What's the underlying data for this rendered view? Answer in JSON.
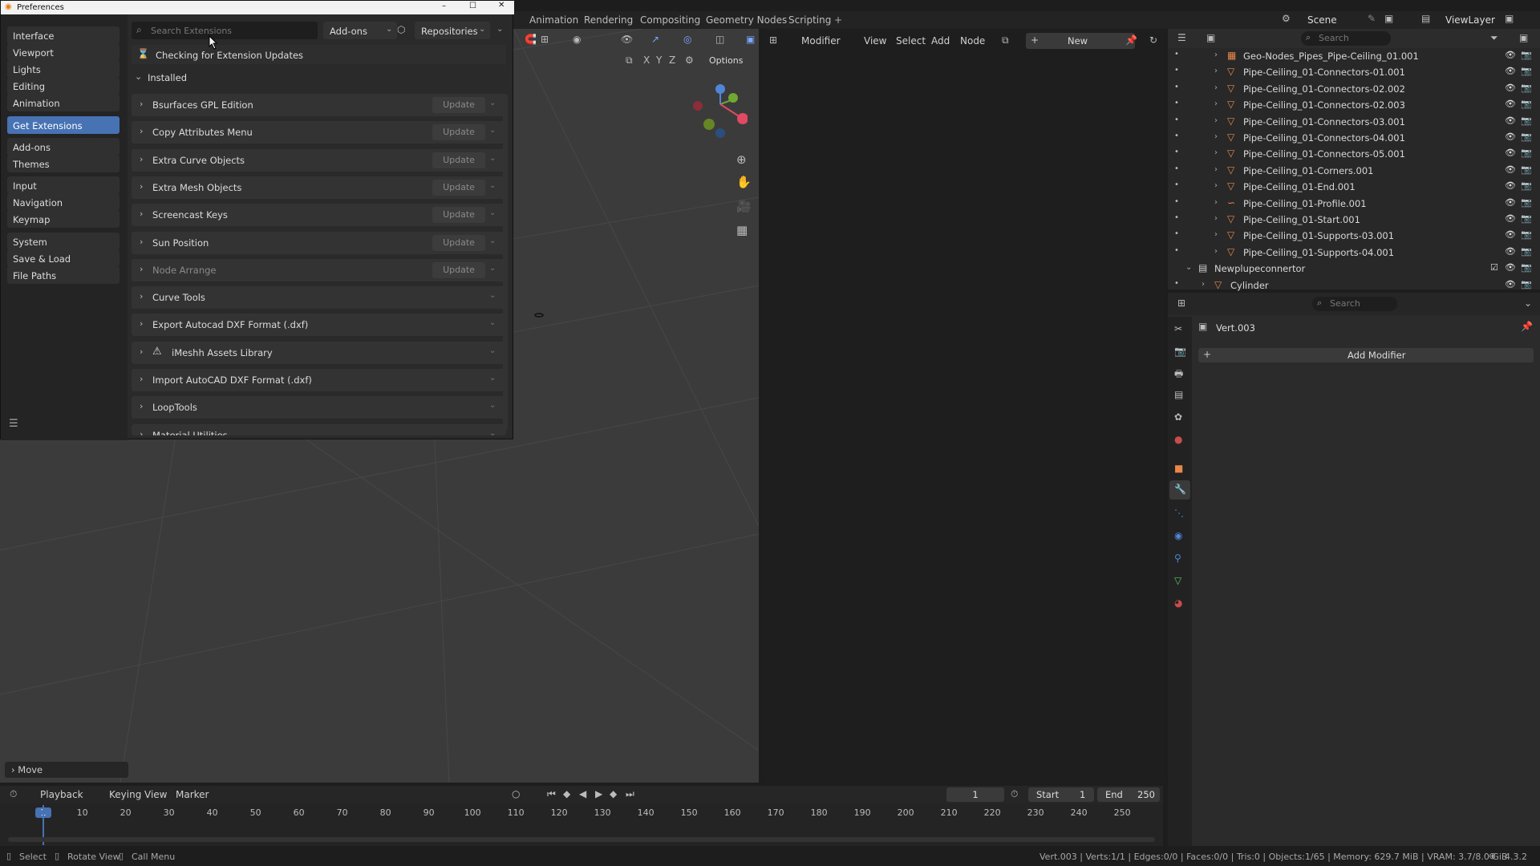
{
  "workspace_tabs": [
    "Animation",
    "Rendering",
    "Compositing",
    "Geometry Nodes",
    "Scripting"
  ],
  "add_workspace": "+",
  "scene": {
    "label": "Scene",
    "view_layer": "ViewLayer"
  },
  "viewport": {
    "axes": [
      "X",
      "Y",
      "Z"
    ],
    "options_label": "Options"
  },
  "node_editor": {
    "editor_type": "Modifier",
    "menu": [
      "View",
      "Select",
      "Add",
      "Node"
    ],
    "new_label": "New"
  },
  "outliner": {
    "search_placeholder": "Search",
    "rows": [
      {
        "name": "Geo-Nodes_Pipes_Pipe-Ceiling_01.001",
        "icon": "geo-nodes-icon"
      },
      {
        "name": "Pipe-Ceiling_01-Connectors-01.001",
        "icon": "mesh-icon"
      },
      {
        "name": "Pipe-Ceiling_01-Connectors-02.002",
        "icon": "mesh-icon"
      },
      {
        "name": "Pipe-Ceiling_01-Connectors-02.003",
        "icon": "mesh-icon"
      },
      {
        "name": "Pipe-Ceiling_01-Connectors-03.001",
        "icon": "mesh-icon"
      },
      {
        "name": "Pipe-Ceiling_01-Connectors-04.001",
        "icon": "mesh-icon"
      },
      {
        "name": "Pipe-Ceiling_01-Connectors-05.001",
        "icon": "mesh-icon"
      },
      {
        "name": "Pipe-Ceiling_01-Corners.001",
        "icon": "mesh-icon"
      },
      {
        "name": "Pipe-Ceiling_01-End.001",
        "icon": "mesh-icon"
      },
      {
        "name": "Pipe-Ceiling_01-Profile.001",
        "icon": "curve-icon"
      },
      {
        "name": "Pipe-Ceiling_01-Start.001",
        "icon": "mesh-icon"
      },
      {
        "name": "Pipe-Ceiling_01-Supports-03.001",
        "icon": "mesh-icon"
      },
      {
        "name": "Pipe-Ceiling_01-Supports-04.001",
        "icon": "mesh-icon"
      },
      {
        "name": "Newplupeconnertor",
        "icon": "collection-icon"
      },
      {
        "name": "Cylinder",
        "icon": "mesh-icon"
      }
    ]
  },
  "properties": {
    "search_placeholder": "Search",
    "object_name": "Vert.003",
    "add_modifier": "Add Modifier"
  },
  "timeline": {
    "menu": [
      "Playback",
      "Keying",
      "View",
      "Marker"
    ],
    "current_frame": "1",
    "start_label": "Start",
    "start": "1",
    "end_label": "End",
    "end": "250",
    "ticks": [
      "1",
      "10",
      "20",
      "30",
      "40",
      "50",
      "60",
      "70",
      "80",
      "90",
      "100",
      "110",
      "120",
      "130",
      "140",
      "150",
      "160",
      "170",
      "180",
      "190",
      "200",
      "210",
      "220",
      "230",
      "240",
      "250"
    ]
  },
  "status_bar": {
    "left": [
      {
        "icon": "mouse-left-icon",
        "label": "Select"
      },
      {
        "icon": "mouse-middle-icon",
        "label": "Rotate View"
      },
      {
        "icon": "mouse-right-icon",
        "label": "Call Menu"
      }
    ],
    "right": "Vert.003 | Verts:1/1 | Edges:0/0 | Faces:0/0 | Tris:0 | Objects:1/65 | Memory: 629.7 MiB | VRAM: 3.7/8.0 GiB",
    "version": "4.3.2"
  },
  "last_operator": "Move",
  "preferences": {
    "title": "Preferences",
    "sidebar": [
      {
        "label": "Interface",
        "group": 1
      },
      {
        "label": "Viewport",
        "group": 1
      },
      {
        "label": "Lights",
        "group": 1
      },
      {
        "label": "Editing",
        "group": 1
      },
      {
        "label": "Animation",
        "group": 1
      },
      {
        "label": "Get Extensions",
        "group": 2,
        "active": true
      },
      {
        "label": "Add-ons",
        "group": 3
      },
      {
        "label": "Themes",
        "group": 3
      },
      {
        "label": "Input",
        "group": 4
      },
      {
        "label": "Navigation",
        "group": 4
      },
      {
        "label": "Keymap",
        "group": 4
      },
      {
        "label": "System",
        "group": 5
      },
      {
        "label": "Save & Load",
        "group": 5
      },
      {
        "label": "File Paths",
        "group": 5
      }
    ],
    "search_placeholder": "Search Extensions",
    "filter_dropdown": "Add-ons",
    "repositories_dropdown": "Repositories",
    "checking_label": "Checking for Extension Updates",
    "installed_label": "Installed",
    "update_label": "Update",
    "extensions": [
      {
        "name": "Bsurfaces GPL Edition",
        "update": true
      },
      {
        "name": "Copy Attributes Menu",
        "update": true
      },
      {
        "name": "Extra Curve Objects",
        "update": true
      },
      {
        "name": "Extra Mesh Objects",
        "update": true
      },
      {
        "name": "Screencast Keys",
        "update": true
      },
      {
        "name": "Sun Position",
        "update": true
      },
      {
        "name": "Node Arrange",
        "update": true,
        "disabled": true
      },
      {
        "name": "Curve Tools",
        "update": false
      },
      {
        "name": "Export Autocad DXF Format (.dxf)",
        "update": false
      },
      {
        "name": "iMeshh Assets Library",
        "update": false,
        "warning": true
      },
      {
        "name": "Import AutoCAD DXF Format (.dxf)",
        "update": false
      },
      {
        "name": "LoopTools",
        "update": false
      },
      {
        "name": "Material Utilities",
        "update": false
      }
    ]
  }
}
